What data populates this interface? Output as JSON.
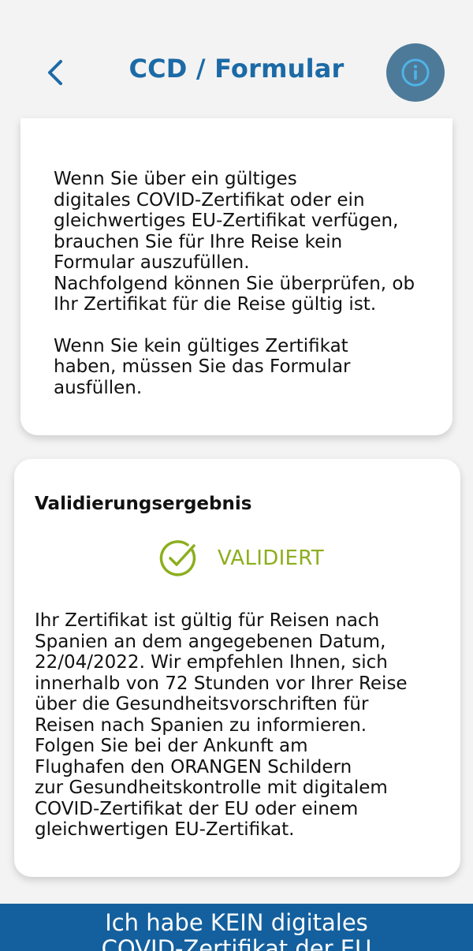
{
  "header": {
    "title": "CCD / Formular",
    "back_icon": "chevron-left-icon",
    "info_icon": "info-icon"
  },
  "info_card": {
    "paragraph1": "Wenn Sie über ein gültiges\ndigitales COVID-Zertifikat oder ein\ngleichwertiges EU-Zertifikat verfügen,\nbrauchen Sie für Ihre Reise kein\nFormular auszufüllen.\nNachfolgend können Sie überprüfen, ob\nIhr Zertifikat für die Reise gültig ist.",
    "paragraph2": "Wenn Sie kein gültiges Zertifikat\nhaben, müssen Sie das Formular\nausfüllen."
  },
  "result_card": {
    "heading": "Validierungsergebnis",
    "status_icon": "check-circle-icon",
    "status": "VALIDIERT",
    "text": "Ihr Zertifikat ist gültig für Reisen nach\nSpanien an dem angegebenen Datum,\n22/04/2022. Wir empfehlen Ihnen, sich\ninnerhalb von 72 Stunden vor Ihrer Reise\nüber die Gesundheitsvorschriften für\nReisen nach Spanien zu informieren.\nFolgen Sie bei der Ankunft am\nFlughafen den ORANGEN Schildern\nzur Gesundheitskontrolle mit digitalem\nCOVID-Zertifikat der EU oder einem\ngleichwertigen EU-Zertifikat."
  },
  "bottom_button": {
    "label": "Ich habe KEIN digitales\nCOVID-Zertifikat der EU"
  },
  "colors": {
    "accent_blue": "#1c6aa6",
    "info_button": "#4d7a99",
    "status_green": "#8cae1e",
    "bottom_bar": "#14609e"
  }
}
